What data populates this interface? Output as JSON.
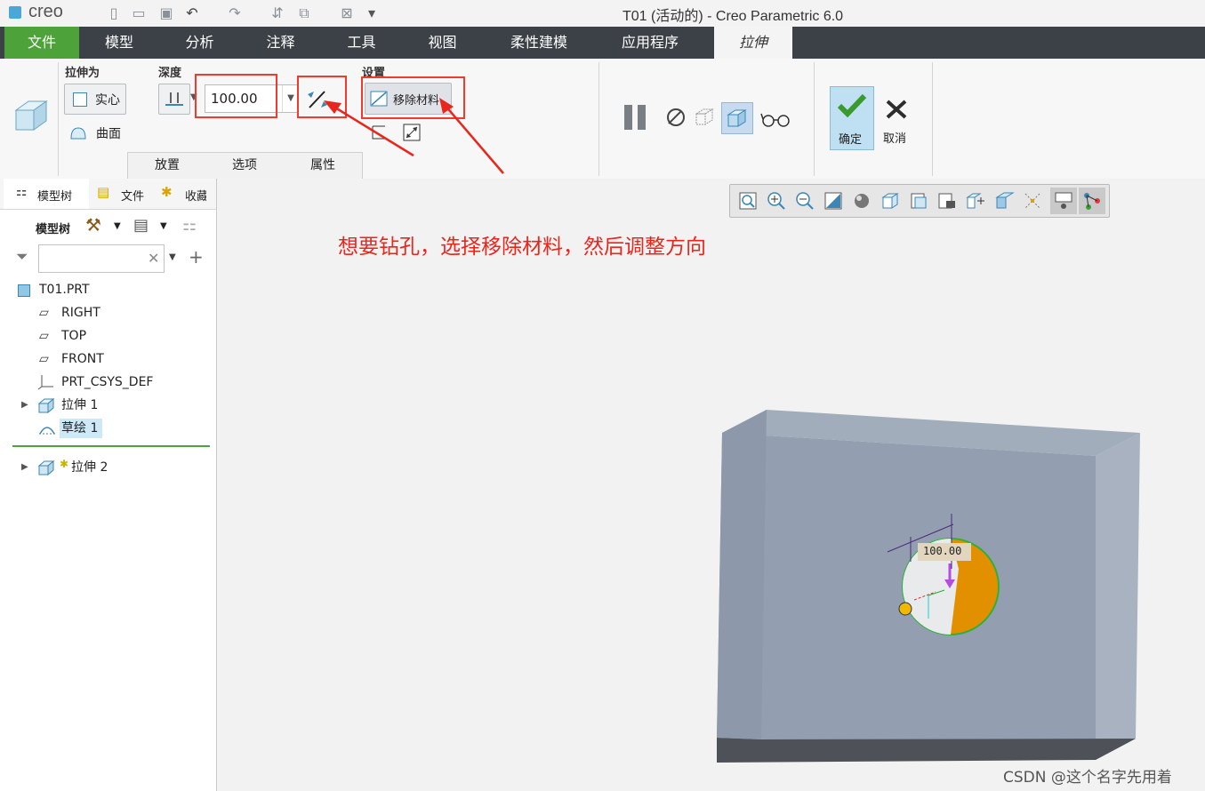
{
  "app": {
    "logo": "creo",
    "title": "T01 (活动的) - Creo Parametric 6.0"
  },
  "tabs": [
    {
      "label": "文件"
    },
    {
      "label": "模型"
    },
    {
      "label": "分析"
    },
    {
      "label": "注释"
    },
    {
      "label": "工具"
    },
    {
      "label": "视图"
    },
    {
      "label": "柔性建模"
    },
    {
      "label": "应用程序"
    },
    {
      "label": "拉伸"
    }
  ],
  "ribbon": {
    "extrude_as_label": "拉伸为",
    "solid_label": "实心",
    "surface_label": "曲面",
    "depth_label": "深度",
    "depth_value": "100.00",
    "settings_label": "设置",
    "remove_material_label": "移除材料",
    "sub_tabs": [
      "放置",
      "选项",
      "属性"
    ],
    "ok_label": "确定",
    "cancel_label": "取消"
  },
  "left_panel": {
    "tabs": [
      "模型树",
      "文件",
      "收藏"
    ],
    "header_label": "模型树",
    "filter_placeholder": "",
    "tree": [
      {
        "label": "T01.PRT",
        "icon": "part-icon"
      },
      {
        "label": "RIGHT",
        "icon": "datum-plane-icon"
      },
      {
        "label": "TOP",
        "icon": "datum-plane-icon"
      },
      {
        "label": "FRONT",
        "icon": "datum-plane-icon"
      },
      {
        "label": "PRT_CSYS_DEF",
        "icon": "csys-icon"
      },
      {
        "label": "拉伸 1",
        "icon": "extrude-icon"
      },
      {
        "label": "草绘 1",
        "icon": "sketch-icon"
      },
      {
        "label": "拉伸 2",
        "icon": "extrude-icon"
      }
    ]
  },
  "viewport": {
    "annotation": "想要钻孔，选择移除材料，然后调整方向",
    "dimension": "100.00",
    "watermark": "CSDN @这个名字先用着"
  },
  "colors": {
    "file_tab": "#4ea23a",
    "tab_bar": "#3c4148",
    "annotation_red": "#e8261c",
    "block": "#939fb0",
    "hole_orange": "#e39000"
  }
}
